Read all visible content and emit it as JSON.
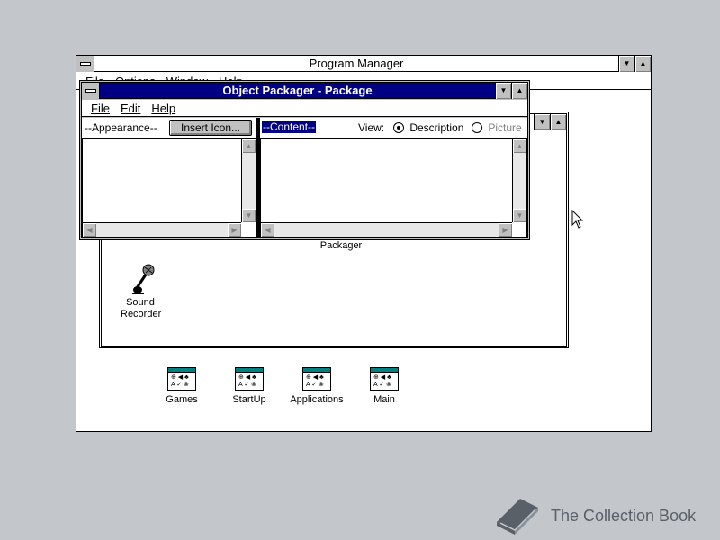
{
  "program_manager": {
    "title": "Program Manager",
    "menu": [
      "File",
      "Options",
      "Window",
      "Help"
    ],
    "groups": [
      "Games",
      "StartUp",
      "Applications",
      "Main"
    ]
  },
  "accessories": {
    "icons": [
      "Packager",
      "Sound Recorder"
    ]
  },
  "packager": {
    "title": "Object Packager - Package",
    "menu": [
      "File",
      "Edit",
      "Help"
    ],
    "appearance_label": "--Appearance--",
    "insert_icon_label": "Insert Icon...",
    "content_label": "--Content--",
    "view_label": "View:",
    "view_options": [
      "Description",
      "Picture"
    ],
    "view_selected": "Description"
  },
  "watermark": {
    "text": "The Collection Book"
  }
}
